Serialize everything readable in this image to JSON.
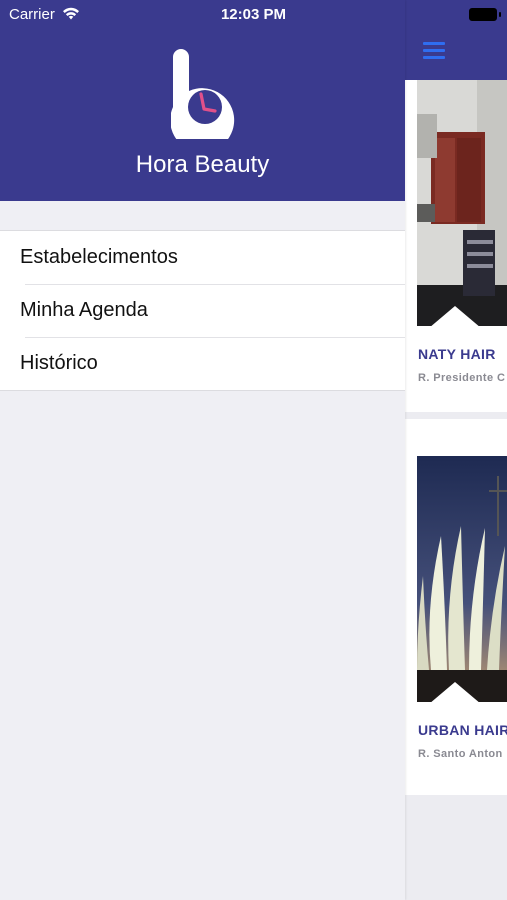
{
  "status_bar": {
    "carrier": "Carrier",
    "time": "12:03 PM"
  },
  "drawer": {
    "app_name": "Hora Beauty",
    "menu": [
      {
        "label": "Estabelecimentos"
      },
      {
        "label": "Minha Agenda"
      },
      {
        "label": "Histórico"
      }
    ]
  },
  "content": {
    "cards": [
      {
        "name": "NATY HAIR",
        "address": "R. Presidente C"
      },
      {
        "name": "URBAN HAIR",
        "address": "R. Santo Anton"
      }
    ]
  },
  "colors": {
    "brand": "#3a3a8e",
    "accent": "#2f6df0",
    "logo_hand": "#e0508a"
  }
}
